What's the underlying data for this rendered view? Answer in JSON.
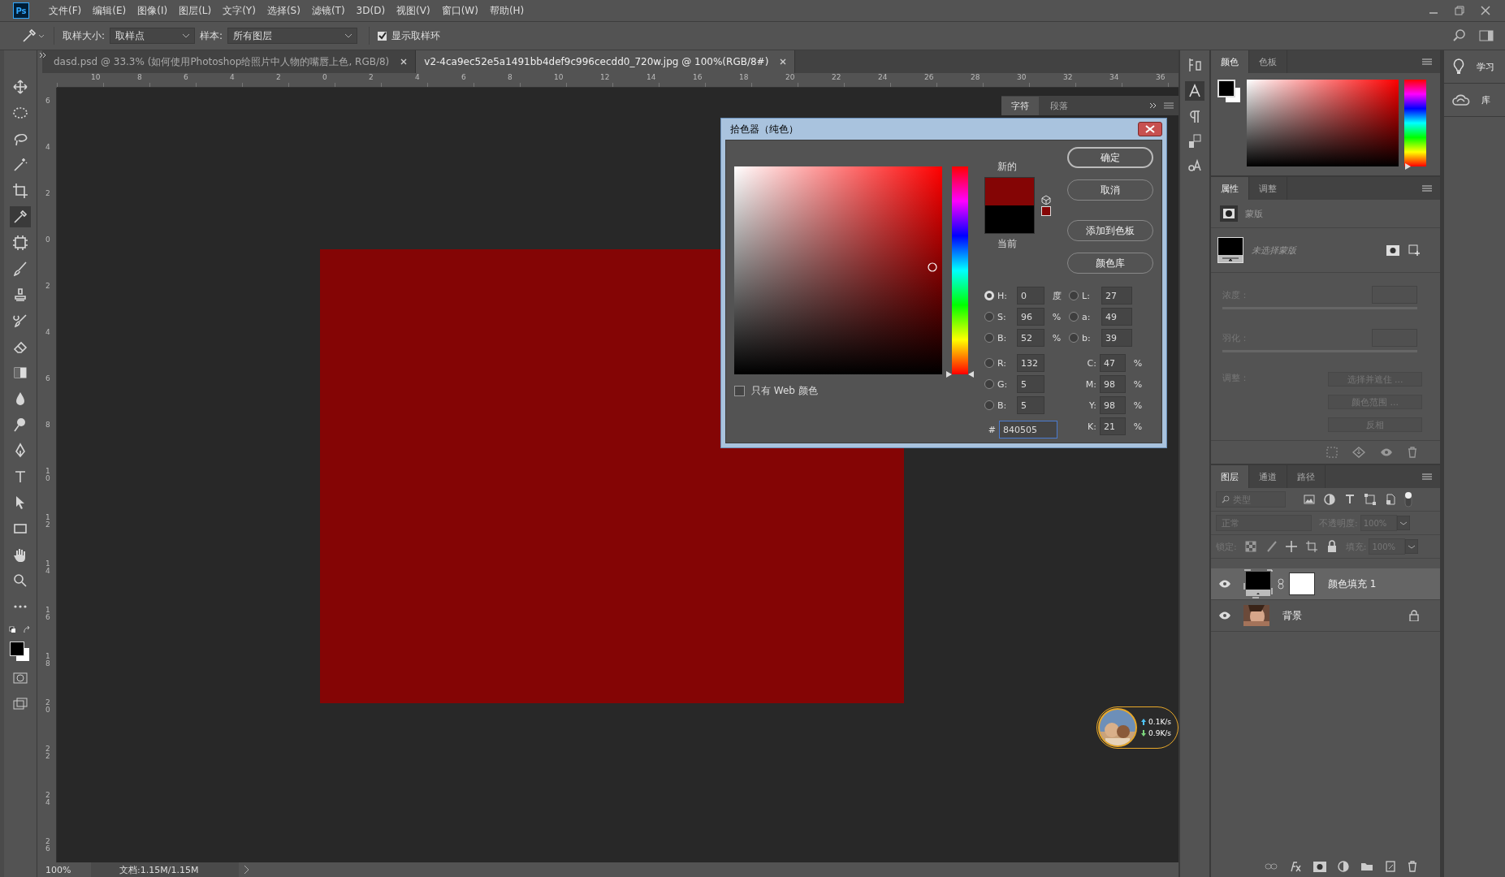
{
  "app_icon": "Ps",
  "menu": [
    "文件(F)",
    "编辑(E)",
    "图像(I)",
    "图层(L)",
    "文字(Y)",
    "选择(S)",
    "滤镜(T)",
    "3D(D)",
    "视图(V)",
    "窗口(W)",
    "帮助(H)"
  ],
  "options_bar": {
    "sample_size_label": "取样大小:",
    "sample_size_value": "取样点",
    "sample_label": "样本:",
    "sample_value": "所有图层",
    "show_ring": {
      "label": "显示取样环",
      "checked": true
    }
  },
  "document_tabs": [
    {
      "label": "dasd.psd @ 33.3% (如何使用Photoshop给照片中人物的嘴唇上色, RGB/8)",
      "selected": false
    },
    {
      "label": "v2-4ca9ec52e5a1491bb4def9c996cecdd0_720w.jpg @ 100%(RGB/8#)",
      "selected": true
    }
  ],
  "ruler": {
    "x_labels": [
      "10",
      "8",
      "6",
      "4",
      "2",
      "0",
      "2",
      "4",
      "6",
      "8",
      "10",
      "12",
      "14",
      "16",
      "18",
      "20",
      "22",
      "24",
      "26",
      "28",
      "30",
      "32",
      "34",
      "36"
    ],
    "y_labels": [
      "6",
      "4",
      "2",
      "0",
      "2",
      "4",
      "6",
      "8",
      "10",
      "12",
      "14",
      "16",
      "18",
      "20",
      "22",
      "24",
      "26"
    ]
  },
  "char_panel": {
    "tabs": [
      {
        "label": "字符",
        "selected": true
      },
      {
        "label": "段落",
        "selected": false
      }
    ]
  },
  "color_picker": {
    "title": "拾色器（纯色）",
    "new_label": "新的",
    "current_label": "当前",
    "buttons": [
      "确定",
      "取消",
      "添加到色板",
      "颜色库"
    ],
    "web_only": {
      "label": "只有 Web 颜色",
      "checked": false
    },
    "hsb_rgb": [
      {
        "label": "H:",
        "value": "0",
        "unit": "度",
        "selected": true
      },
      {
        "label": "S:",
        "value": "96",
        "unit": "%",
        "selected": false
      },
      {
        "label": "B:",
        "value": "52",
        "unit": "%",
        "selected": false
      },
      {
        "label": "R:",
        "value": "132",
        "selected": false
      },
      {
        "label": "G:",
        "value": "5",
        "selected": false
      },
      {
        "label": "B:",
        "value": "5",
        "selected": false
      }
    ],
    "lab": [
      {
        "label": "L:",
        "value": "27",
        "selected": false
      },
      {
        "label": "a:",
        "value": "49",
        "selected": false
      },
      {
        "label": "b:",
        "value": "39",
        "selected": false
      }
    ],
    "cmyk": [
      {
        "label": "C:",
        "value": "47",
        "unit": "%"
      },
      {
        "label": "M:",
        "value": "98",
        "unit": "%"
      },
      {
        "label": "Y:",
        "value": "98",
        "unit": "%"
      },
      {
        "label": "K:",
        "value": "21",
        "unit": "%"
      }
    ],
    "hex": {
      "label": "#",
      "value": "840505"
    },
    "hue": {
      "level": 0
    }
  },
  "color_panel": {
    "tabs": [
      {
        "label": "颜色",
        "selected": true
      },
      {
        "label": "色板",
        "selected": false
      }
    ],
    "hue": {
      "level": 0
    }
  },
  "properties_panel": {
    "tabs": [
      {
        "label": "属性",
        "selected": true
      },
      {
        "label": "调整",
        "selected": false
      }
    ],
    "section": "蒙版",
    "mask_status": "未选择蒙版",
    "density_label": "浓度：",
    "feather_label": "羽化：",
    "adjust_label": "调整：",
    "buttons": [
      "选择并遮住 ...",
      "颜色范围 ...",
      "反相"
    ]
  },
  "layers_panel": {
    "tabs": [
      {
        "label": "图层",
        "selected": true
      },
      {
        "label": "通道",
        "selected": false
      },
      {
        "label": "路径",
        "selected": false
      }
    ],
    "filter_placeholder": "类型",
    "filter_toggle": {
      "on": true
    },
    "blend_mode": "正常",
    "opacity_label": "不透明度:",
    "opacity": "100%",
    "lock_label": "锁定:",
    "fill_label": "填充:",
    "fill": "100%",
    "layers": [
      {
        "name": "颜色填充 1",
        "kind": "fill",
        "visible": true,
        "selected": true,
        "locked": false
      },
      {
        "name": "背景",
        "visible": true,
        "selected": false,
        "locked": true
      }
    ]
  },
  "side_panels": [
    {
      "label": "学习",
      "kind": "learn"
    },
    {
      "label": "库",
      "kind": "library"
    }
  ],
  "status_bar": {
    "zoom": "100%",
    "doc": "文档:1.15M/1.15M"
  },
  "net_widget": {
    "up": "0.1K/s",
    "down": "0.9K/s"
  }
}
